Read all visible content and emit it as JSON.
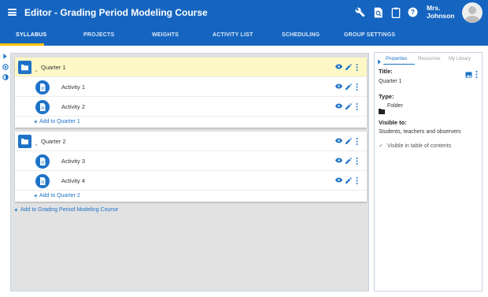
{
  "header": {
    "title": "Editor - Grading Period Modeling Course",
    "user_name_line1": "Mrs.",
    "user_name_line2": "Johnson",
    "icons": [
      "menu-icon",
      "wrench-icon",
      "preview-icon",
      "clipboard-icon",
      "help-icon",
      "avatar"
    ]
  },
  "tabs": [
    {
      "label": "SYLLABUS",
      "active": true
    },
    {
      "label": "PROJECTS",
      "active": false
    },
    {
      "label": "WEIGHTS",
      "active": false
    },
    {
      "label": "ACTIVITY LIST",
      "active": false
    },
    {
      "label": "SCHEDULING",
      "active": false
    },
    {
      "label": "GROUP SETTINGS",
      "active": false
    }
  ],
  "syllabus": {
    "folders": [
      {
        "name": "Quarter 1",
        "selected": true,
        "activities": [
          {
            "name": "Activity 1"
          },
          {
            "name": "Activity 2"
          }
        ],
        "add_label": "Add to Quarter 1"
      },
      {
        "name": "Quarter 2",
        "selected": false,
        "activities": [
          {
            "name": "Activity 3"
          },
          {
            "name": "Activity 4"
          }
        ],
        "add_label": "Add to Quarter 2"
      }
    ],
    "add_course_label": "Add to Grading Period Modeling Course"
  },
  "panel": {
    "tabs": [
      {
        "label": "Properties",
        "active": true
      },
      {
        "label": "Resources",
        "active": false
      },
      {
        "label": "My Library",
        "active": false
      }
    ],
    "title_label": "Title:",
    "title_value": "Quarter 1",
    "type_label": "Type:",
    "type_value": "Folder",
    "visible_label": "Visible to:",
    "visible_value": "Students, teachers and observers",
    "toc_label": "Visible in table of contents",
    "toc_checked": true
  },
  "colors": {
    "primary": "#1565c0",
    "accent_blue": "#1e73c8",
    "tab_indicator": "#ffc107",
    "selected_row": "#fdf8c6",
    "canvas_bg": "#e2e2e2"
  }
}
